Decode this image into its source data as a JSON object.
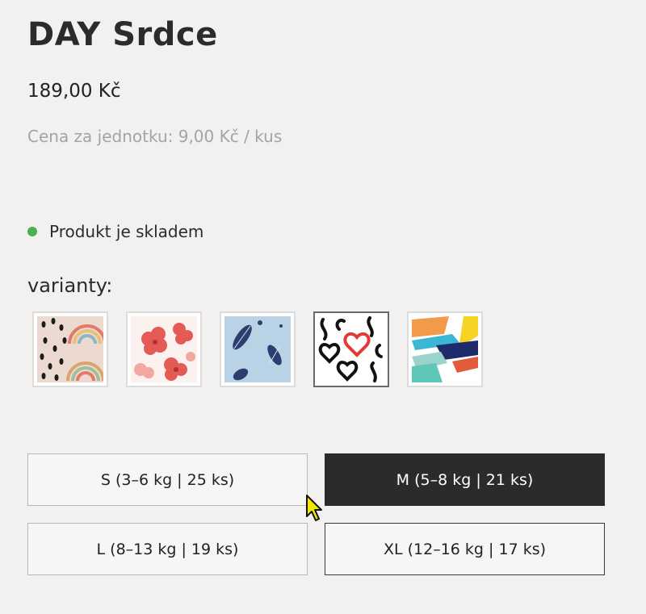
{
  "product": {
    "title": "DAY Srdce",
    "price": "189,00 Kč",
    "unit_price": "Cena za jednotku: 9,00 Kč / kus"
  },
  "stock": {
    "text": "Produkt je skladem",
    "dot_color": "#4caf50"
  },
  "variants": {
    "label": "varianty:",
    "swatches": [
      {
        "name": "rainbow-dots-pattern"
      },
      {
        "name": "red-flowers-pattern"
      },
      {
        "name": "feathers-pattern"
      },
      {
        "name": "hearts-pattern",
        "selected": true
      },
      {
        "name": "paint-strokes-pattern"
      }
    ]
  },
  "sizes": [
    {
      "label": "S (3–6 kg | 25 ks)"
    },
    {
      "label": "M (5–8 kg | 21 ks)",
      "selected": true
    },
    {
      "label": "L (8–13 kg | 19 ks)"
    },
    {
      "label": "XL (12–16 kg | 17 ks)"
    }
  ]
}
